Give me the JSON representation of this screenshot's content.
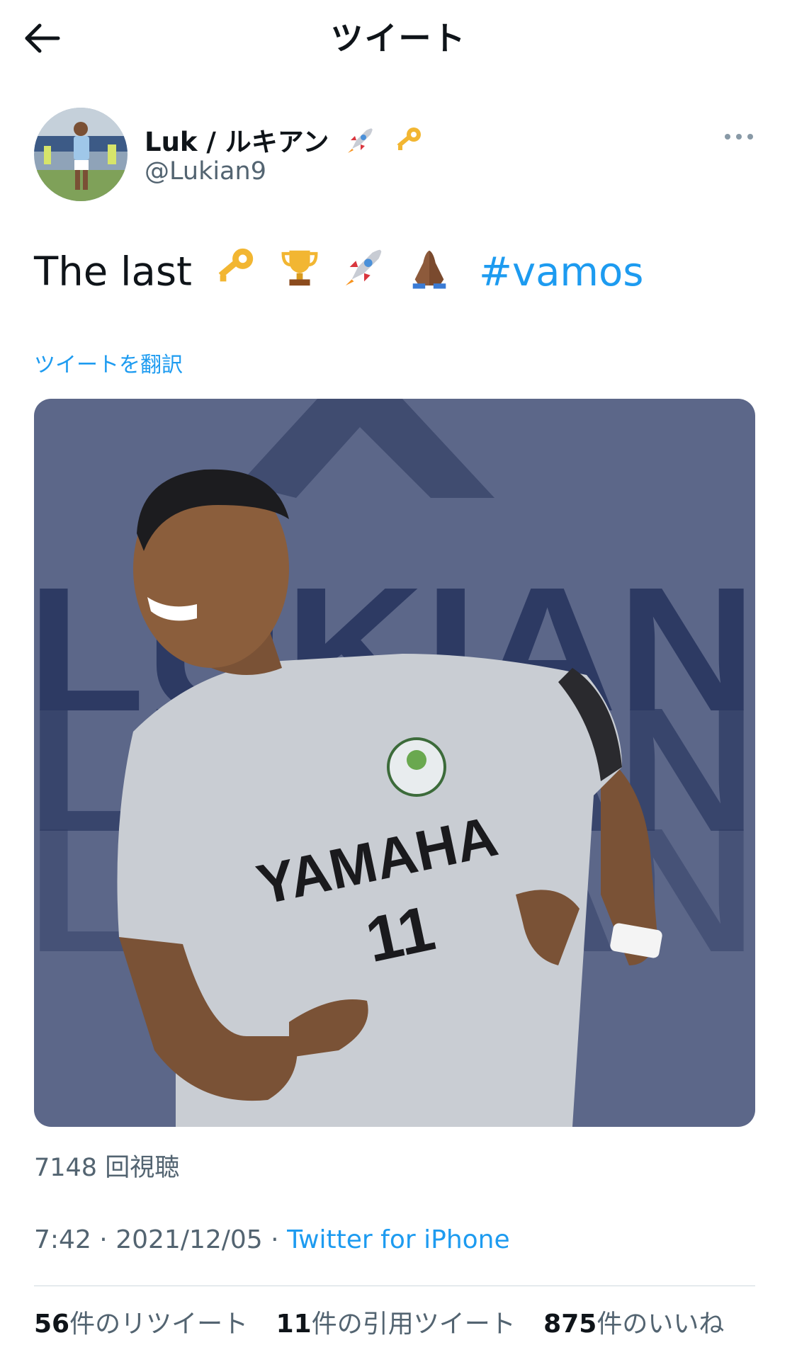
{
  "header": {
    "title": "ツイート",
    "back_icon": "arrow-left-icon"
  },
  "author": {
    "display_name": "Luk / ルキアン",
    "name_emojis": [
      "rocket-icon",
      "key-icon"
    ],
    "handle": "@Lukian9"
  },
  "menu_icon": "more-horizontal-icon",
  "tweet": {
    "text": "The last",
    "emojis": [
      "key-icon",
      "trophy-icon",
      "rocket-icon",
      "folded-hands-icon"
    ],
    "hashtag": "#vamos",
    "translate_label": "ツイートを翻訳"
  },
  "media": {
    "bg_text": "LUKIAN",
    "shirt_brand": "YAMAHA",
    "shirt_number": "11"
  },
  "views_label": "7148 回視聴",
  "meta": {
    "time": "7:42",
    "separator": "·",
    "date": "2021/12/05",
    "source": "Twitter for iPhone"
  },
  "stats": {
    "retweets_count": "56",
    "retweets_label": "件のリツイート",
    "quotes_count": "11",
    "quotes_label": "件の引用ツイート",
    "likes_count": "875",
    "likes_label": "件のいいね"
  },
  "colors": {
    "link": "#1d9bf0",
    "secondary": "#536471",
    "media_bg": "#5c6789"
  }
}
